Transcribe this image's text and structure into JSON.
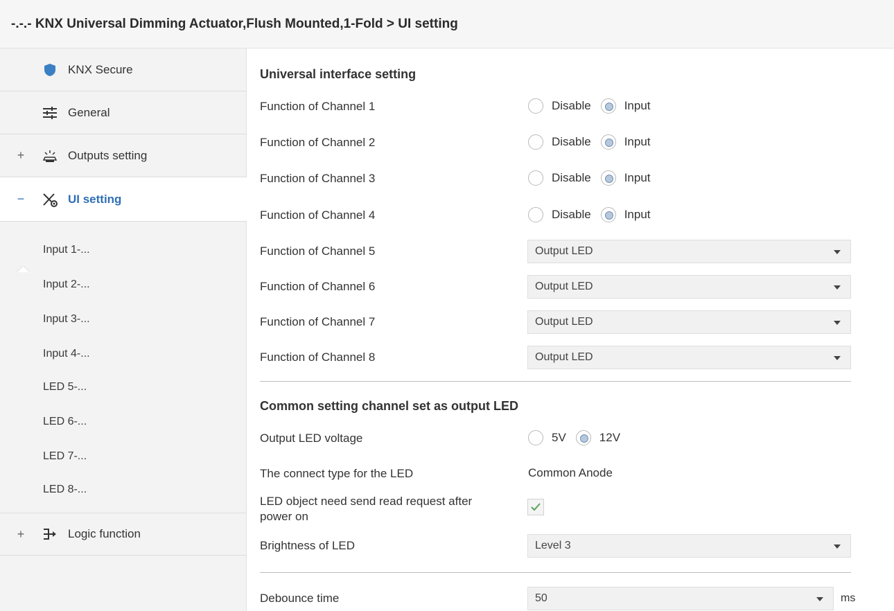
{
  "window": {
    "title": "-.-.- KNX Universal Dimming Actuator,Flush Mounted,1-Fold > UI setting"
  },
  "sidebar": {
    "items": [
      {
        "label": "KNX Secure",
        "icon": "shield-icon",
        "expander": ""
      },
      {
        "label": "General",
        "icon": "sliders-icon",
        "expander": ""
      },
      {
        "label": "Outputs setting",
        "icon": "lamp-icon",
        "expander": "+"
      },
      {
        "label": "UI setting",
        "icon": "ui-tools-icon",
        "expander": "−"
      },
      {
        "label": "Logic function",
        "icon": "logic-gate-icon",
        "expander": "+"
      }
    ],
    "sub_items": [
      "Input 1-...",
      "Input 2-...",
      "Input 3-...",
      "Input 4-...",
      "LED 5-...",
      "LED 6-...",
      "LED 7-...",
      "LED 8-..."
    ]
  },
  "main": {
    "section1_title": "Universal interface setting",
    "radio_options": {
      "disable": "Disable",
      "input": "Input"
    },
    "channels_radio": [
      {
        "label": "Function of Channel 1",
        "selected": "Input"
      },
      {
        "label": "Function of Channel 2",
        "selected": "Input"
      },
      {
        "label": "Function of Channel 3",
        "selected": "Input"
      },
      {
        "label": "Function of Channel 4",
        "selected": "Input"
      }
    ],
    "channels_select": [
      {
        "label": "Function of Channel 5",
        "value": "Output LED"
      },
      {
        "label": "Function of Channel 6",
        "value": "Output LED"
      },
      {
        "label": "Function of Channel 7",
        "value": "Output LED"
      },
      {
        "label": "Function of Channel 8",
        "value": "Output LED"
      }
    ],
    "section2_title": "Common setting channel set as output LED",
    "voltage": {
      "label": "Output LED voltage",
      "options": [
        "5V",
        "12V"
      ],
      "selected": "12V"
    },
    "connect_type": {
      "label": "The connect type for the LED",
      "value": "Common Anode"
    },
    "read_request": {
      "label_line1": "LED object need send read request after",
      "label_line2": "power on",
      "checked": true
    },
    "brightness": {
      "label": "Brightness of LED",
      "value": "Level 3"
    },
    "debounce": {
      "label": "Debounce time",
      "value": "50",
      "unit": "ms"
    }
  },
  "colors": {
    "accent": "#2f6fb5",
    "shield": "#3b7fc4",
    "check": "#5aa05a"
  }
}
